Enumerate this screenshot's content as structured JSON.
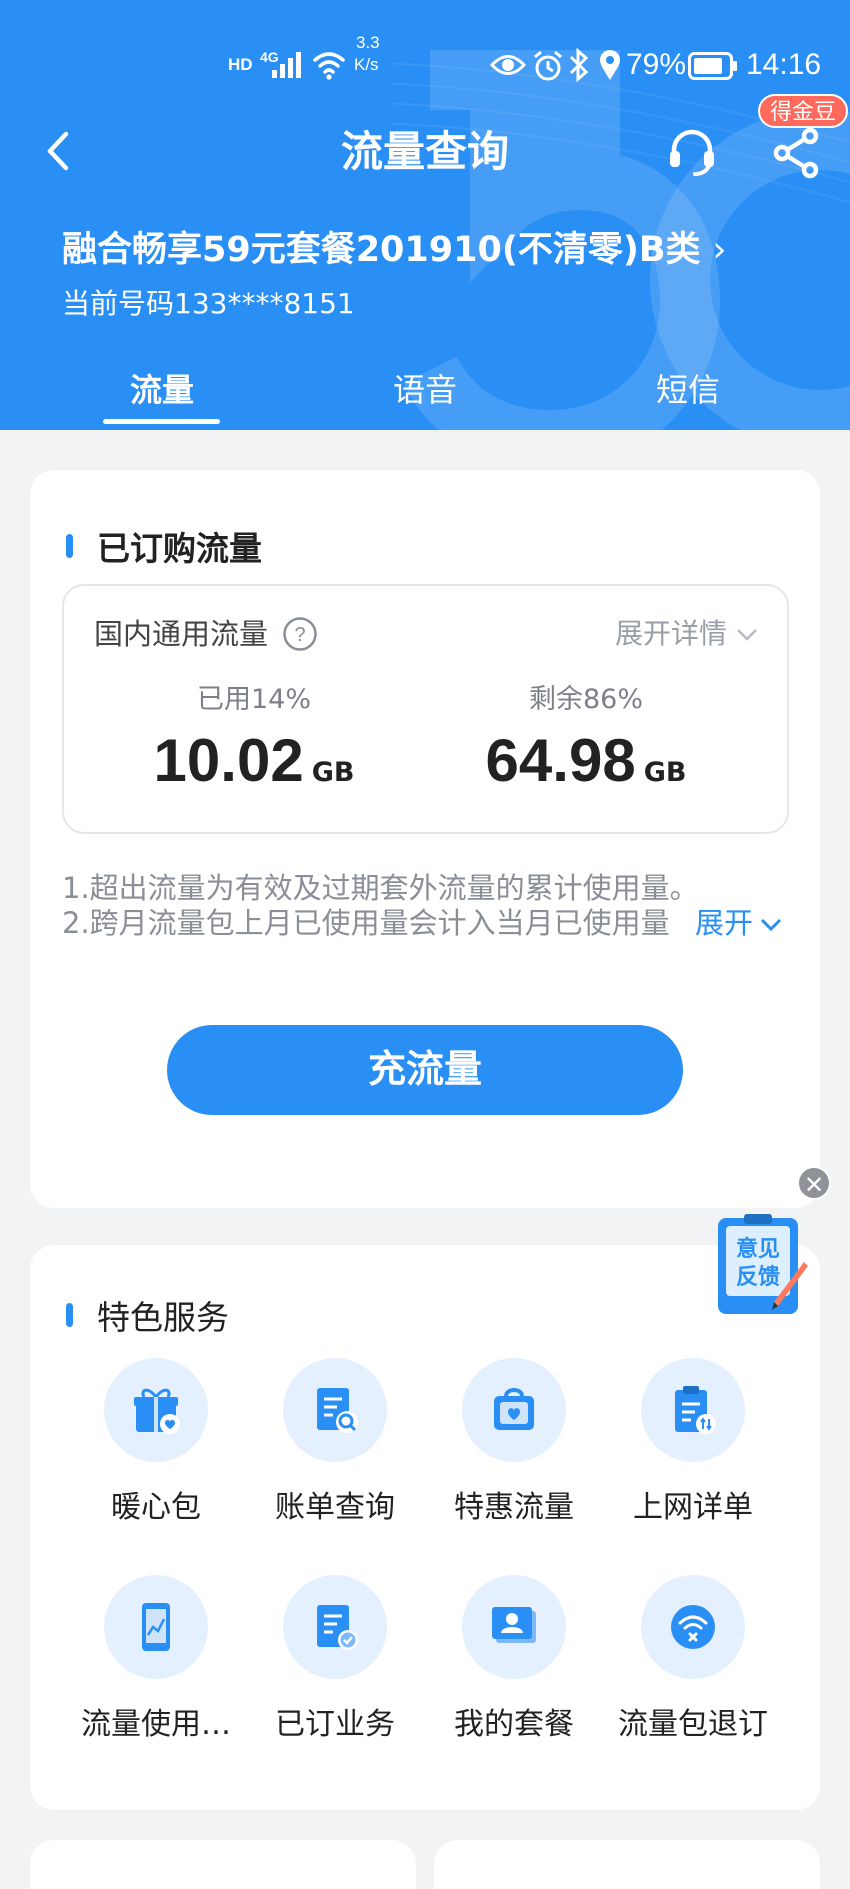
{
  "status_bar": {
    "network": "HD",
    "signal": "4G",
    "speed_value": "3.3",
    "speed_unit": "K/s",
    "battery": "79%",
    "time": "14:16"
  },
  "nav": {
    "title": "流量查询",
    "coin_badge": "得金豆"
  },
  "plan": {
    "name": "融合畅享59元套餐201910(不清零)B类",
    "phone": "当前号码133****8151"
  },
  "tabs": [
    {
      "label": "流量",
      "active": true
    },
    {
      "label": "语音",
      "active": false
    },
    {
      "label": "短信",
      "active": false
    }
  ],
  "subscribed": {
    "title": "已订购流量",
    "box_label": "国内通用流量",
    "expand_detail": "展开详情",
    "used_label": "已用14%",
    "used_value": "10.02",
    "used_unit": "GB",
    "remain_label": "剩余86%",
    "remain_value": "64.98",
    "remain_unit": "GB",
    "note1": "1.超出流量为有效及过期套外流量的累计使用量。",
    "note2": "2.跨月流量包上月已使用量会计入当月已使用量",
    "expand_link": "展开",
    "recharge_label": "充流量"
  },
  "feedback": {
    "line1": "意见",
    "line2": "反馈"
  },
  "services": {
    "title": "特色服务",
    "items": [
      {
        "label": "暖心包",
        "icon": "gift-icon"
      },
      {
        "label": "账单查询",
        "icon": "bill-search-icon"
      },
      {
        "label": "特惠流量",
        "icon": "bag-heart-icon"
      },
      {
        "label": "上网详单",
        "icon": "clipboard-icon"
      },
      {
        "label": "流量使用…",
        "icon": "phone-chart-icon"
      },
      {
        "label": "已订业务",
        "icon": "doc-check-icon"
      },
      {
        "label": "我的套餐",
        "icon": "profile-card-icon"
      },
      {
        "label": "流量包退订",
        "icon": "wifi-cancel-icon"
      }
    ]
  },
  "colors": {
    "brand": "#2a8ff4",
    "badge": "#ff6a5c"
  }
}
